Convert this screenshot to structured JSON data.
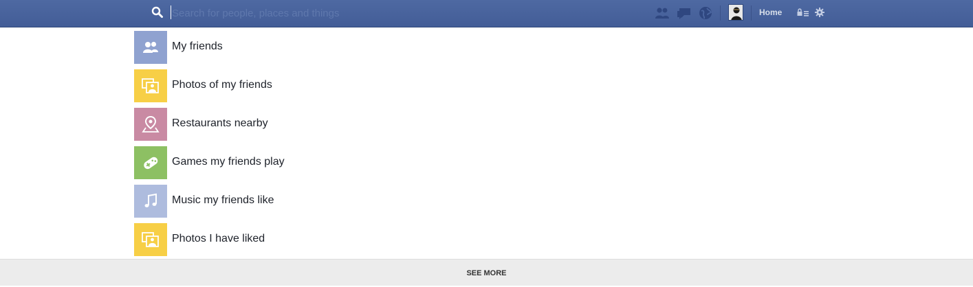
{
  "search": {
    "placeholder": "Search for people, places and things",
    "value": ""
  },
  "header": {
    "home_label": "Home"
  },
  "colors": {
    "topbar": "#4b66a0",
    "tile_blue": "#8fa2d0",
    "tile_yellow": "#f7cf46",
    "tile_pink": "#c98aa3",
    "tile_green": "#8dc063",
    "tile_lightblue": "#aebcde"
  },
  "suggestions": [
    {
      "label": "My friends",
      "icon": "friends-icon",
      "color": "#8fa2d0"
    },
    {
      "label": "Photos of my friends",
      "icon": "photos-icon",
      "color": "#f7cf46"
    },
    {
      "label": "Restaurants nearby",
      "icon": "map-pin-icon",
      "color": "#c98aa3"
    },
    {
      "label": "Games my friends play",
      "icon": "gamepad-icon",
      "color": "#8dc063"
    },
    {
      "label": "Music my friends like",
      "icon": "music-note-icon",
      "color": "#aebcde"
    },
    {
      "label": "Photos I have liked",
      "icon": "photos-icon",
      "color": "#f7cf46"
    }
  ],
  "footer": {
    "see_more_label": "SEE MORE"
  }
}
